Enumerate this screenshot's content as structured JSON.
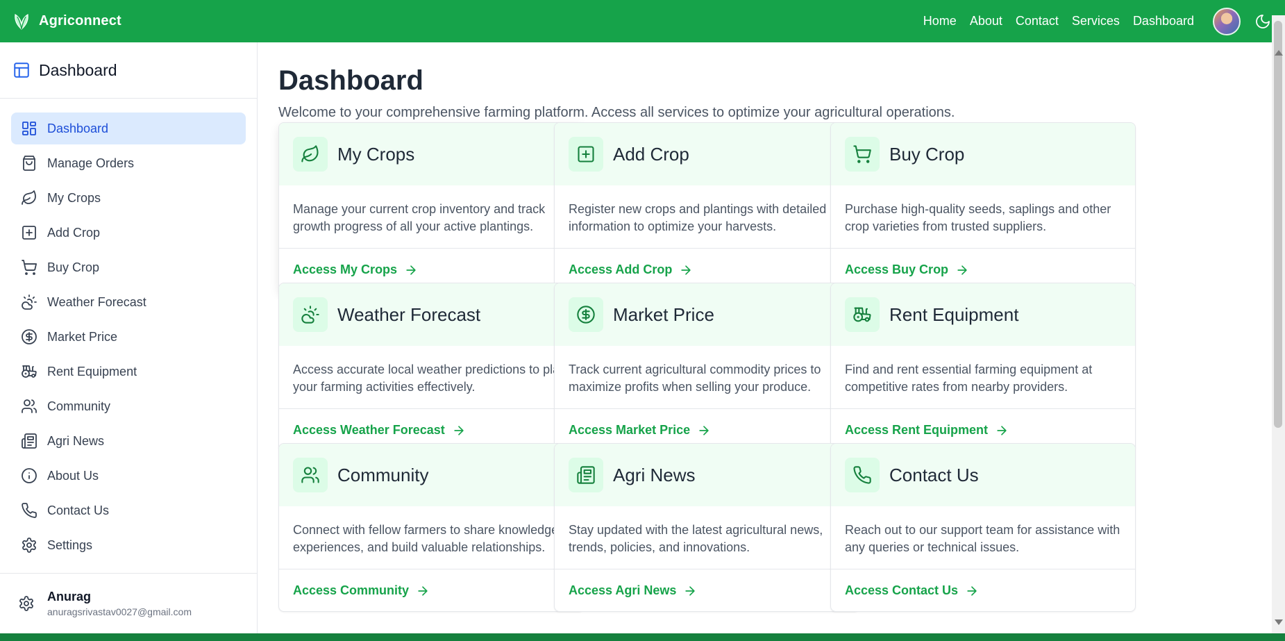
{
  "brand": {
    "name": "Agriconnect"
  },
  "nav": {
    "links": [
      "Home",
      "About",
      "Contact",
      "Services",
      "Dashboard"
    ],
    "theme_icon": "moon-icon"
  },
  "sidebar": {
    "title": "Dashboard",
    "items": [
      {
        "label": "Dashboard",
        "icon": "grid-icon",
        "active": true
      },
      {
        "label": "Manage Orders",
        "icon": "shopping-bag-icon"
      },
      {
        "label": "My Crops",
        "icon": "leaf-icon"
      },
      {
        "label": "Add Crop",
        "icon": "plus-square-icon"
      },
      {
        "label": "Buy Crop",
        "icon": "cart-icon"
      },
      {
        "label": "Weather Forecast",
        "icon": "cloud-sun-icon"
      },
      {
        "label": "Market Price",
        "icon": "dollar-circle-icon"
      },
      {
        "label": "Rent Equipment",
        "icon": "tractor-icon"
      },
      {
        "label": "Community",
        "icon": "users-icon"
      },
      {
        "label": "Agri News",
        "icon": "newspaper-icon"
      },
      {
        "label": "About Us",
        "icon": "info-icon"
      },
      {
        "label": "Contact Us",
        "icon": "phone-icon"
      },
      {
        "label": "Settings",
        "icon": "gear-icon"
      }
    ],
    "user": {
      "name": "Anurag",
      "email": "anuragsrivastav0027@gmail.com"
    }
  },
  "main": {
    "title": "Dashboard",
    "subtitle": "Welcome to your comprehensive farming platform. Access all services to optimize your agricultural operations.",
    "cards": [
      {
        "title": "My Crops",
        "icon": "leaf-icon",
        "description": "Manage your current crop inventory and track growth progress of all your active plantings.",
        "link": "Access My Crops"
      },
      {
        "title": "Add Crop",
        "icon": "plus-square-icon",
        "description": "Register new crops and plantings with detailed information to optimize your harvests.",
        "link": "Access Add Crop"
      },
      {
        "title": "Buy Crop",
        "icon": "cart-icon",
        "description": "Purchase high-quality seeds, saplings and other crop varieties from trusted suppliers.",
        "link": "Access Buy Crop"
      },
      {
        "title": "Weather Forecast",
        "icon": "cloud-sun-icon",
        "description": "Access accurate local weather predictions to plan your farming activities effectively.",
        "link": "Access Weather Forecast"
      },
      {
        "title": "Market Price",
        "icon": "dollar-circle-icon",
        "description": "Track current agricultural commodity prices to maximize profits when selling your produce.",
        "link": "Access Market Price"
      },
      {
        "title": "Rent Equipment",
        "icon": "tractor-icon",
        "description": "Find and rent essential farming equipment at competitive rates from nearby providers.",
        "link": "Access Rent Equipment"
      },
      {
        "title": "Community",
        "icon": "users-icon",
        "description": "Connect with fellow farmers to share knowledge, experiences, and build valuable relationships.",
        "link": "Access Community"
      },
      {
        "title": "Agri News",
        "icon": "newspaper-icon",
        "description": "Stay updated with the latest agricultural news, trends, policies, and innovations.",
        "link": "Access Agri News"
      },
      {
        "title": "Contact Us",
        "icon": "phone-icon",
        "description": "Reach out to our support team for assistance with any queries or technical issues.",
        "link": "Access Contact Us"
      }
    ]
  },
  "colors": {
    "primary": "#16a34a",
    "active_bg": "#dbeafe",
    "active_text": "#1d4ed8",
    "card_head": "#f0fdf4"
  }
}
